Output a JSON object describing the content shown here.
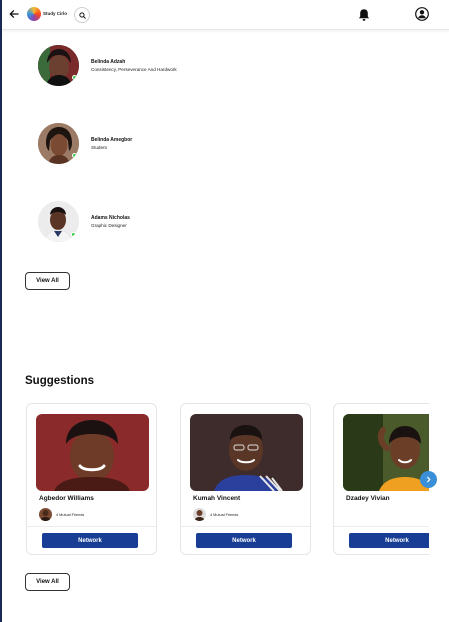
{
  "header": {
    "app_name": "Study Cirlo",
    "icons": [
      "back-arrow-icon",
      "app-logo",
      "search-icon",
      "bell-icon",
      "user-account-icon"
    ]
  },
  "people": [
    {
      "name": "Belinda Adzah",
      "role": "Consistency, Perseverance And Hardwork",
      "online": true
    },
    {
      "name": "Belinda Amegbor",
      "role": "Student",
      "online": true
    },
    {
      "name": "Adams Nicholas",
      "role": "Graphic Designer",
      "online": true
    }
  ],
  "people_view_all_label": "View All",
  "suggestions": {
    "title": "Suggestions",
    "cards": [
      {
        "name": "Agbedor Williams",
        "mutual": "4 Mutual Friends",
        "button": "Network"
      },
      {
        "name": "Kumah Vincent",
        "mutual": "4 Mutual Friends",
        "button": "Network"
      },
      {
        "name": "Dzadey Vivian",
        "mutual": "",
        "button": "Network"
      }
    ],
    "view_all_label": "View All"
  },
  "colors": {
    "accent_navy": "#173e94",
    "online_green": "#2ecc40",
    "carousel_arrow": "#3a8fd6"
  }
}
